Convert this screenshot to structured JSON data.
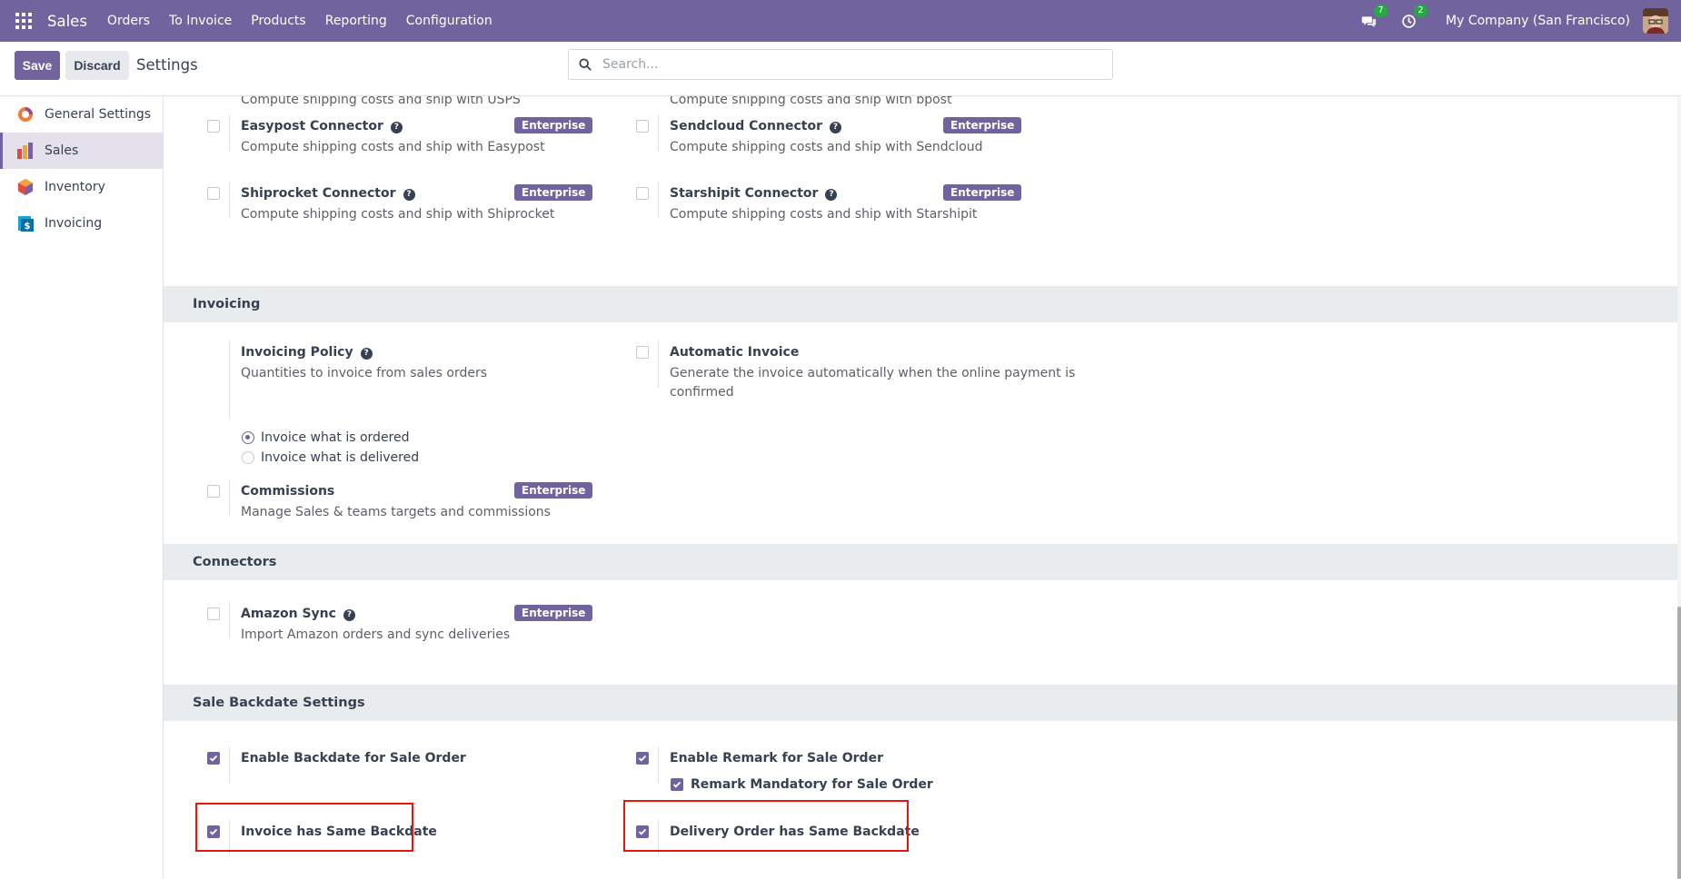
{
  "navbar": {
    "app_name": "Sales",
    "menu": [
      "Orders",
      "To Invoice",
      "Products",
      "Reporting",
      "Configuration"
    ],
    "messages_count": "7",
    "activities_count": "2",
    "company": "My Company (San Francisco)"
  },
  "control_panel": {
    "save_label": "Save",
    "discard_label": "Discard",
    "title": "Settings",
    "search_placeholder": "Search..."
  },
  "sidebar": {
    "items": [
      {
        "label": "General Settings",
        "icon": "odoo-settings-icon"
      },
      {
        "label": "Sales",
        "icon": "sales-app-icon",
        "active": true
      },
      {
        "label": "Inventory",
        "icon": "inventory-app-icon"
      },
      {
        "label": "Invoicing",
        "icon": "invoicing-app-icon"
      }
    ]
  },
  "shipping": {
    "usps_desc": "Compute shipping costs and ship with USPS",
    "bpost_desc": "Compute shipping costs and ship with bpost",
    "easypost": {
      "label": "Easypost Connector",
      "desc": "Compute shipping costs and ship with Easypost",
      "badge": "Enterprise"
    },
    "sendcloud": {
      "label": "Sendcloud Connector",
      "desc": "Compute shipping costs and ship with Sendcloud",
      "badge": "Enterprise"
    },
    "shiprocket": {
      "label": "Shiprocket Connector",
      "desc": "Compute shipping costs and ship with Shiprocket",
      "badge": "Enterprise"
    },
    "starshipit": {
      "label": "Starshipit Connector",
      "desc": "Compute shipping costs and ship with Starshipit",
      "badge": "Enterprise"
    }
  },
  "invoicing": {
    "title": "Invoicing",
    "policy": {
      "label": "Invoicing Policy",
      "desc": "Quantities to invoice from sales orders",
      "options": [
        "Invoice what is ordered",
        "Invoice what is delivered"
      ],
      "selected": "Invoice what is ordered"
    },
    "automatic": {
      "label": "Automatic Invoice",
      "desc_line1": "Generate the invoice automatically when the online payment is",
      "desc_line2": "confirmed"
    },
    "commissions": {
      "label": "Commissions",
      "desc": "Manage Sales & teams targets and commissions",
      "badge": "Enterprise"
    }
  },
  "connectors": {
    "title": "Connectors",
    "amazon": {
      "label": "Amazon Sync",
      "desc": "Import Amazon orders and sync deliveries",
      "badge": "Enterprise"
    }
  },
  "backdate": {
    "title": "Sale Backdate Settings",
    "enable_backdate": {
      "label": "Enable Backdate for Sale Order",
      "checked": true
    },
    "enable_remark": {
      "label": "Enable Remark for Sale Order",
      "checked": true
    },
    "remark_mandatory": {
      "label": "Remark Mandatory for Sale Order",
      "checked": true
    },
    "invoice_same": {
      "label": "Invoice has Same Backdate",
      "checked": true
    },
    "delivery_same": {
      "label": "Delivery Order has Same Backdate",
      "checked": true
    }
  },
  "colors": {
    "brand": "#71639e",
    "section_bg": "#e9ecef",
    "highlight": "#e3170a",
    "badge_green": "#28a745"
  }
}
